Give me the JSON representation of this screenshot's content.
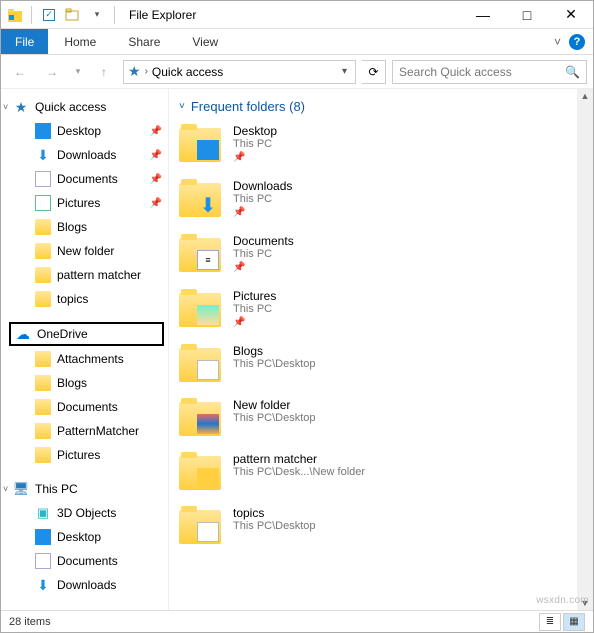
{
  "window": {
    "title": "File Explorer"
  },
  "ribbon": {
    "file": "File",
    "tabs": [
      "Home",
      "Share",
      "View"
    ],
    "expand_glyph": "˅"
  },
  "nav": {
    "address": "Quick access",
    "search_placeholder": "Search Quick access"
  },
  "tree": {
    "quick_access": {
      "label": "Quick access"
    },
    "qa_items": [
      {
        "label": "Desktop",
        "icon": "desktop",
        "pinned": true
      },
      {
        "label": "Downloads",
        "icon": "downloads",
        "pinned": true
      },
      {
        "label": "Documents",
        "icon": "documents",
        "pinned": true
      },
      {
        "label": "Pictures",
        "icon": "pictures",
        "pinned": true
      },
      {
        "label": "Blogs",
        "icon": "folder",
        "pinned": false
      },
      {
        "label": "New folder",
        "icon": "folder",
        "pinned": false
      },
      {
        "label": "pattern matcher",
        "icon": "folder",
        "pinned": false
      },
      {
        "label": "topics",
        "icon": "folder",
        "pinned": false
      }
    ],
    "onedrive": {
      "label": "OneDrive"
    },
    "od_items": [
      {
        "label": "Attachments"
      },
      {
        "label": "Blogs"
      },
      {
        "label": "Documents"
      },
      {
        "label": "PatternMatcher"
      },
      {
        "label": "Pictures"
      }
    ],
    "thispc": {
      "label": "This PC"
    },
    "pc_items": [
      {
        "label": "3D Objects",
        "icon": "obj3d"
      },
      {
        "label": "Desktop",
        "icon": "desktop"
      },
      {
        "label": "Documents",
        "icon": "documents"
      },
      {
        "label": "Downloads",
        "icon": "downloads"
      }
    ]
  },
  "content": {
    "section_title": "Frequent folders (8)",
    "items": [
      {
        "name": "Desktop",
        "sub": "This PC",
        "pinned": true,
        "overlay": "desktop"
      },
      {
        "name": "Downloads",
        "sub": "This PC",
        "pinned": true,
        "overlay": "dl"
      },
      {
        "name": "Documents",
        "sub": "This PC",
        "pinned": true,
        "overlay": "doc"
      },
      {
        "name": "Pictures",
        "sub": "This PC",
        "pinned": true,
        "overlay": "pic"
      },
      {
        "name": "Blogs",
        "sub": "This PC\\Desktop",
        "pinned": false,
        "overlay": "blog"
      },
      {
        "name": "New folder",
        "sub": "This PC\\Desktop",
        "pinned": false,
        "overlay": "nf"
      },
      {
        "name": "pattern matcher",
        "sub": "This PC\\Desk...\\New folder",
        "pinned": false,
        "overlay": "pm"
      },
      {
        "name": "topics",
        "sub": "This PC\\Desktop",
        "pinned": false,
        "overlay": "tp"
      }
    ]
  },
  "status": {
    "text": "28 items"
  },
  "watermark": "wsxdn.com",
  "glyphs": {
    "pin": "📌",
    "star": "★",
    "back": "←",
    "fwd": "→",
    "up": "↑",
    "chev_down": "▾",
    "refresh": "⟳",
    "search": "🔍",
    "min": "—",
    "max": "□",
    "close": "✕",
    "qat_props": "✓",
    "qat_new": "▭",
    "dd": "▾",
    "expand_right": "›",
    "expand_down": "˅",
    "cloud": "☁",
    "monitor": "🖥",
    "cube": "▣",
    "dl_arrow": "⬇"
  }
}
